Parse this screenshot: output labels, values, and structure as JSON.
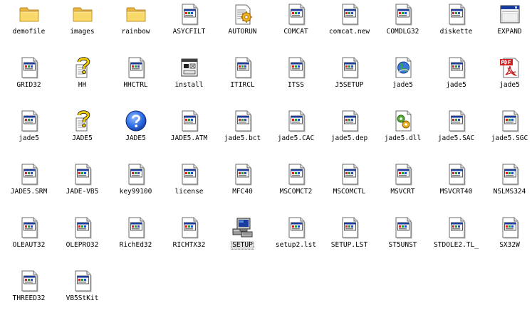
{
  "files": [
    {
      "name": "demofile",
      "icon": "folder-icon"
    },
    {
      "name": "images",
      "icon": "folder-icon"
    },
    {
      "name": "rainbow",
      "icon": "folder-icon"
    },
    {
      "name": "ASYCFILT",
      "icon": "file-icon"
    },
    {
      "name": "AUTORUN",
      "icon": "autorun-icon"
    },
    {
      "name": "COMCAT",
      "icon": "file-icon"
    },
    {
      "name": "comcat.new",
      "icon": "file-icon"
    },
    {
      "name": "COMDLG32",
      "icon": "file-icon"
    },
    {
      "name": "diskette",
      "icon": "file-icon"
    },
    {
      "name": "EXPAND",
      "icon": "window-icon"
    },
    {
      "name": "GRID32",
      "icon": "file-icon"
    },
    {
      "name": "HH",
      "icon": "help-file-icon"
    },
    {
      "name": "HHCTRL",
      "icon": "file-icon"
    },
    {
      "name": "install",
      "icon": "installer-icon"
    },
    {
      "name": "ITIRCL",
      "icon": "file-icon"
    },
    {
      "name": "ITSS",
      "icon": "file-icon"
    },
    {
      "name": "J5SETUP",
      "icon": "file-icon"
    },
    {
      "name": "jade5",
      "icon": "web-file-icon"
    },
    {
      "name": "jade5",
      "icon": "file-icon"
    },
    {
      "name": "jade5",
      "icon": "pdf-icon"
    },
    {
      "name": "jade5",
      "icon": "file-icon"
    },
    {
      "name": "JADE5",
      "icon": "help-file-icon"
    },
    {
      "name": "JADE5",
      "icon": "help-icon"
    },
    {
      "name": "JADE5.ATM",
      "icon": "file-icon"
    },
    {
      "name": "jade5.bct",
      "icon": "file-icon"
    },
    {
      "name": "jade5.CAC",
      "icon": "file-icon"
    },
    {
      "name": "jade5.dep",
      "icon": "file-icon"
    },
    {
      "name": "jade5.dll",
      "icon": "dll-icon"
    },
    {
      "name": "jade5.SAC",
      "icon": "file-icon"
    },
    {
      "name": "jade5.SGC",
      "icon": "file-icon"
    },
    {
      "name": "JADE5.SRM",
      "icon": "file-icon"
    },
    {
      "name": "JADE-VB5",
      "icon": "file-icon"
    },
    {
      "name": "key99100",
      "icon": "file-icon"
    },
    {
      "name": "license",
      "icon": "file-icon"
    },
    {
      "name": "MFC40",
      "icon": "file-icon"
    },
    {
      "name": "MSCOMCT2",
      "icon": "file-icon"
    },
    {
      "name": "MSCOMCTL",
      "icon": "file-icon"
    },
    {
      "name": "MSVCRT",
      "icon": "file-icon"
    },
    {
      "name": "MSVCRT40",
      "icon": "file-icon"
    },
    {
      "name": "NSLMS324",
      "icon": "file-icon"
    },
    {
      "name": "OLEAUT32",
      "icon": "file-icon"
    },
    {
      "name": "OLEPRO32",
      "icon": "file-icon"
    },
    {
      "name": "RichEd32",
      "icon": "file-icon"
    },
    {
      "name": "RICHTX32",
      "icon": "file-icon"
    },
    {
      "name": "SETUP",
      "icon": "setup-computer-icon",
      "selected": true
    },
    {
      "name": "setup2.lst",
      "icon": "file-icon"
    },
    {
      "name": "SETUP.LST",
      "icon": "file-icon"
    },
    {
      "name": "ST5UNST",
      "icon": "file-icon"
    },
    {
      "name": "STDOLE2.TL_",
      "icon": "file-icon"
    },
    {
      "name": "SX32W",
      "icon": "file-icon"
    },
    {
      "name": "THREED32",
      "icon": "file-icon"
    },
    {
      "name": "VB5StKit",
      "icon": "file-icon"
    }
  ]
}
